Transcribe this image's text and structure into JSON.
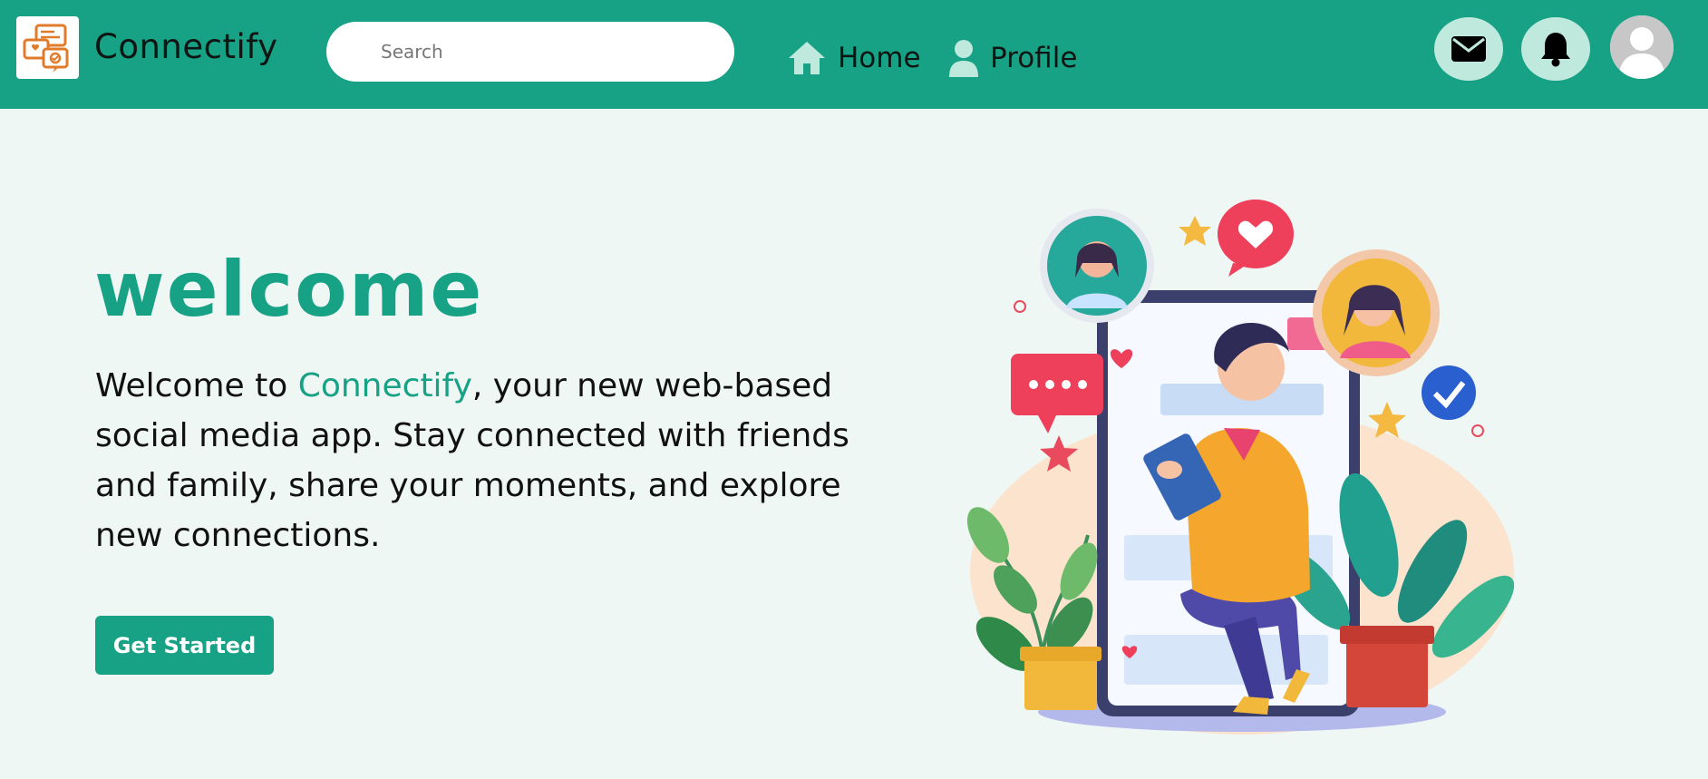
{
  "app": {
    "title": "Connectify"
  },
  "header": {
    "search_placeholder": "Search",
    "nav": [
      {
        "label": "Home",
        "icon": "home-icon"
      },
      {
        "label": "Profile",
        "icon": "user-icon"
      }
    ],
    "actions": [
      {
        "name": "messages",
        "icon": "envelope-icon"
      },
      {
        "name": "notifications",
        "icon": "bell-icon"
      }
    ],
    "avatar_icon": "user-avatar-icon"
  },
  "hero": {
    "heading": "welcome",
    "text_before": "Welcome to ",
    "text_accent": "Connectify",
    "text_after": ", your new web-based social media app. Stay connected with friends and family, share your moments, and explore new connections.",
    "cta_label": "Get Started"
  },
  "colors": {
    "brand": "#17a185",
    "page_bg": "#eef7f4",
    "nav_circle": "#bfe9dc"
  }
}
